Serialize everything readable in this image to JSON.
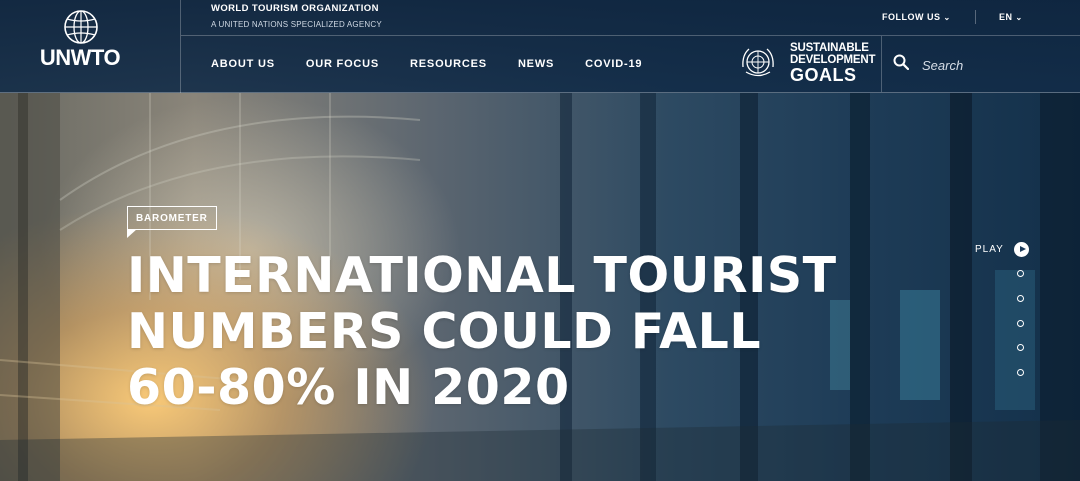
{
  "header": {
    "logo_text": "UNWTO",
    "org_name": "WORLD TOURISM ORGANIZATION",
    "org_subtitle": "A UNITED NATIONS SPECIALIZED AGENCY",
    "follow_us": "FOLLOW US",
    "language": "EN",
    "nav": [
      {
        "label": "ABOUT US"
      },
      {
        "label": "OUR FOCUS"
      },
      {
        "label": "RESOURCES"
      },
      {
        "label": "NEWS"
      },
      {
        "label": "COVID-19"
      }
    ],
    "sdg": {
      "line1": "SUSTAINABLE",
      "line2": "DEVELOPMENT",
      "line3": "GOALS"
    },
    "search": {
      "placeholder": "Search",
      "icon": "search-icon"
    }
  },
  "hero": {
    "badge": "BAROMETER",
    "headline_lines": [
      "INTERNATIONAL TOURIST",
      "NUMBERS COULD FALL",
      "60-80% IN 2020"
    ]
  },
  "slider": {
    "play_label": "PLAY",
    "dot_count": 5
  },
  "colors": {
    "header_bg": "#0f2640",
    "text": "#ffffff",
    "accent_dark": "#1b3a5a"
  }
}
